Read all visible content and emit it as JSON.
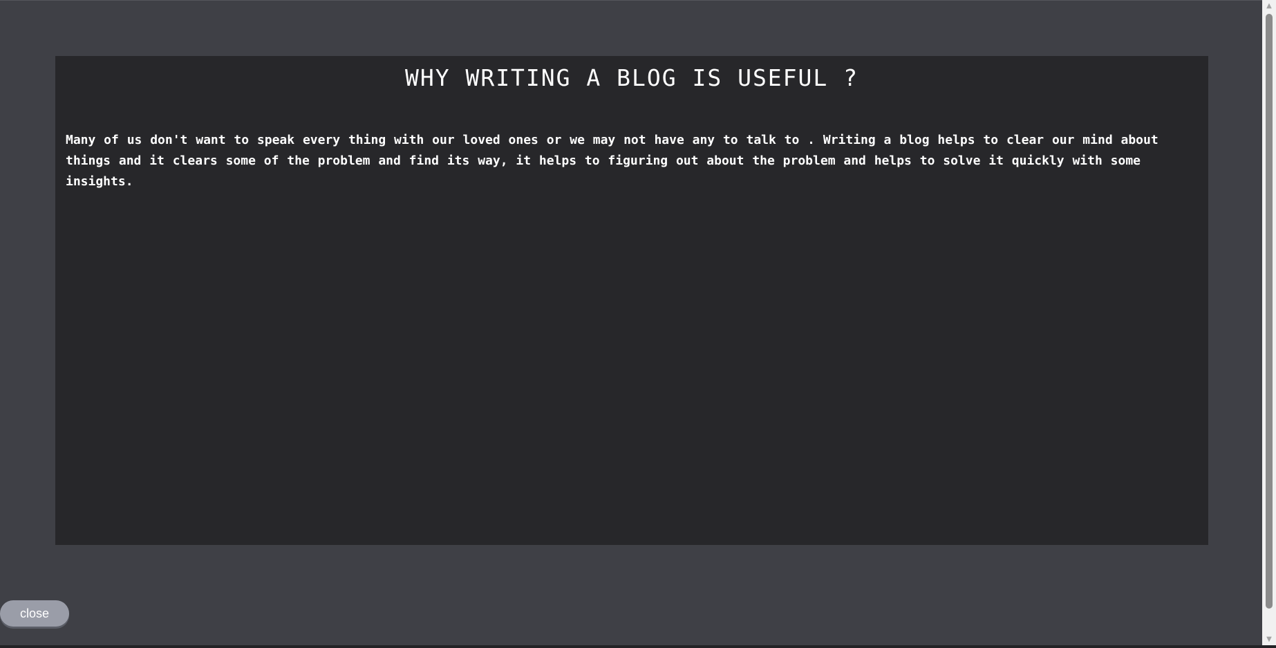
{
  "blog": {
    "title": "WHY WRITING A BLOG IS USEFUL ?",
    "body": "Many of us don't want to speak every thing with our loved ones or we may not have any to talk to . Writing a blog helps to clear our mind about things and it clears some of the problem and find its way, it helps to figuring out about the problem and helps to solve it quickly with some insights."
  },
  "actions": {
    "close_label": "close"
  },
  "colors": {
    "page_background": "#3f4046",
    "panel_background": "#27272a",
    "text": "#ffffff",
    "close_button": "#9a9da8"
  },
  "icons": {
    "scroll_up": "triangle-up-icon",
    "scroll_down": "triangle-down-icon"
  }
}
